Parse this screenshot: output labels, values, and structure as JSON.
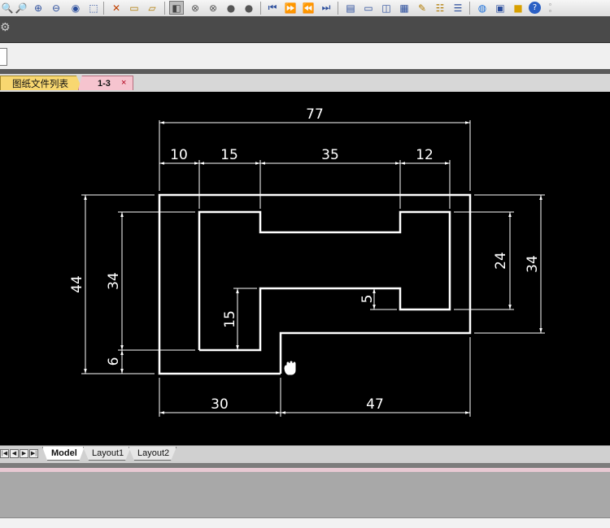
{
  "toolbar": {
    "icons": [
      "zoom-realtime-icon",
      "zoom-window-icon",
      "zoom-in-icon",
      "zoom-out-icon",
      "zoom-previous-icon",
      "zoom-extents-icon",
      "distance-icon",
      "area-icon",
      "measure-icon",
      "layer-icon",
      "hide-icon",
      "shade-icon",
      "render-icon",
      "material-icon",
      "first-icon",
      "next-icon",
      "previous-icon",
      "last-icon",
      "window-icon",
      "split-icon",
      "tile-icon",
      "grid-icon",
      "find-icon",
      "properties-icon",
      "layers-icon",
      "globe-icon",
      "export-icon",
      "folder-icon",
      "help-icon"
    ]
  },
  "tabs": {
    "file_list": "图纸文件列表",
    "drawing": "1-3",
    "close": "×"
  },
  "drawing": {
    "dims": {
      "overall_width": "77",
      "top_left": "10",
      "top_mid": "15",
      "top_center": "35",
      "top_right": "12",
      "left_outer": "44",
      "left_inner": "34",
      "left_small": "6",
      "inner_notch": "15",
      "small_step": "5",
      "right_inner": "24",
      "right_outer": "34",
      "bottom_left": "30",
      "bottom_right": "47"
    }
  },
  "layout_tabs": {
    "model": "Model",
    "layout1": "Layout1",
    "layout2": "Layout2"
  },
  "colors": {
    "canvas_bg": "#000000",
    "geometry": "#ffffff",
    "file_tab": "#f8d770",
    "drawing_tab": "#f6c4cf"
  }
}
